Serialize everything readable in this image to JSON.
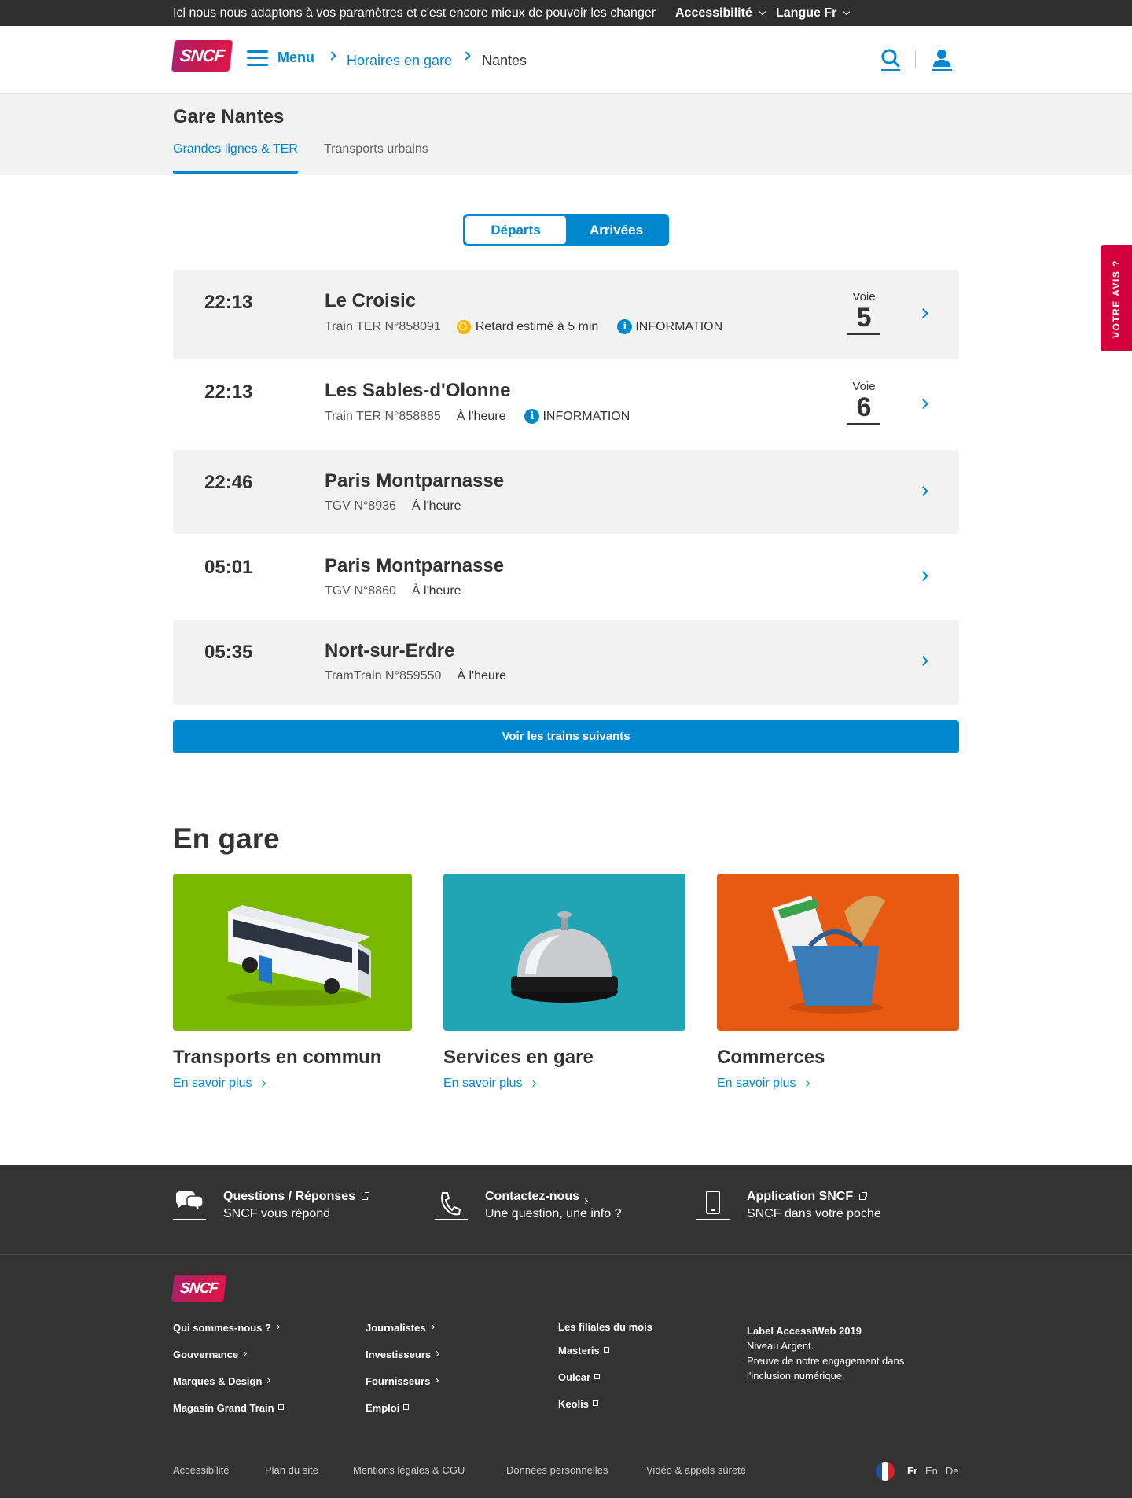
{
  "topbar": {
    "message": "Ici nous nous adaptons à vos paramètres et c'est encore mieux de pouvoir les changer",
    "accessibility": "Accessibilité",
    "language": "Langue Fr"
  },
  "header": {
    "logo": "SNCF",
    "menu_label": "Menu",
    "breadcrumb": [
      "Horaires en gare",
      "Nantes"
    ],
    "icons": [
      "search-icon",
      "user-icon"
    ]
  },
  "station": {
    "title": "Gare Nantes",
    "tabs": [
      "Grandes lignes & TER",
      "Transports urbains"
    ],
    "active_tab": "Grandes lignes & TER"
  },
  "toggle": {
    "departures": "Départs",
    "arrivals": "Arrivées",
    "selected": "Départs"
  },
  "trains": [
    {
      "time": "22:13",
      "destination": "Le Croisic",
      "train": "Train TER N°858091",
      "status": "Retard estimé à 5 min",
      "status_type": "delay",
      "information": "INFORMATION",
      "voie_label": "Voie",
      "voie": "5"
    },
    {
      "time": "22:13",
      "destination": "Les Sables-d'Olonne",
      "train": "Train TER N°858885",
      "status": "À l'heure",
      "status_type": "ontime",
      "information": "INFORMATION",
      "voie_label": "Voie",
      "voie": "6"
    },
    {
      "time": "22:46",
      "destination": "Paris Montparnasse",
      "train": "TGV N°8936",
      "status": "À l'heure",
      "status_type": "ontime"
    },
    {
      "time": "05:01",
      "destination": "Paris Montparnasse",
      "train": "TGV N°8860",
      "status": "À l'heure",
      "status_type": "ontime"
    },
    {
      "time": "05:35",
      "destination": "Nort-sur-Erdre",
      "train": "TramTrain N°859550",
      "status": "À l'heure",
      "status_type": "ontime"
    }
  ],
  "more_button": "Voir les trains suivants",
  "feedback": "VOTRE AVIS ?",
  "en_gare": {
    "title": "En gare",
    "cards": [
      {
        "title": "Transports en commun",
        "link": "En savoir plus",
        "color": "#7ab800"
      },
      {
        "title": "Services en gare",
        "link": "En savoir plus",
        "color": "#1fa5b4"
      },
      {
        "title": "Commerces",
        "link": "En savoir plus",
        "color": "#e85a12"
      }
    ]
  },
  "footer": {
    "contacts": [
      {
        "title": "Questions / Réponses",
        "subtitle": "SNCF vous répond"
      },
      {
        "title": "Contactez-nous",
        "subtitle": "Une question, une info ?"
      },
      {
        "title": "Application SNCF",
        "subtitle": "SNCF dans votre poche"
      }
    ],
    "logo": "SNCF",
    "col1": [
      "Qui sommes-nous ?",
      "Gouvernance",
      "Marques & Design",
      "Magasin Grand Train"
    ],
    "col2": [
      "Journalistes",
      "Investisseurs",
      "Fournisseurs",
      "Emploi"
    ],
    "col3": [
      "Les filiales du mois",
      "Masteris",
      "Ouicar",
      "Keolis"
    ],
    "label_title": "Label AccessiWeb 2019",
    "label_lines": [
      "Niveau Argent.",
      "Preuve de notre engagement dans l'inclusion numérique."
    ],
    "bottom_links": [
      "Accessibilité",
      "Plan du site",
      "Mentions légales & CGU",
      "Données personnelles",
      "Vidéo & appels sûreté"
    ],
    "languages": [
      "Fr",
      "En",
      "De"
    ],
    "current_language": "Fr"
  }
}
